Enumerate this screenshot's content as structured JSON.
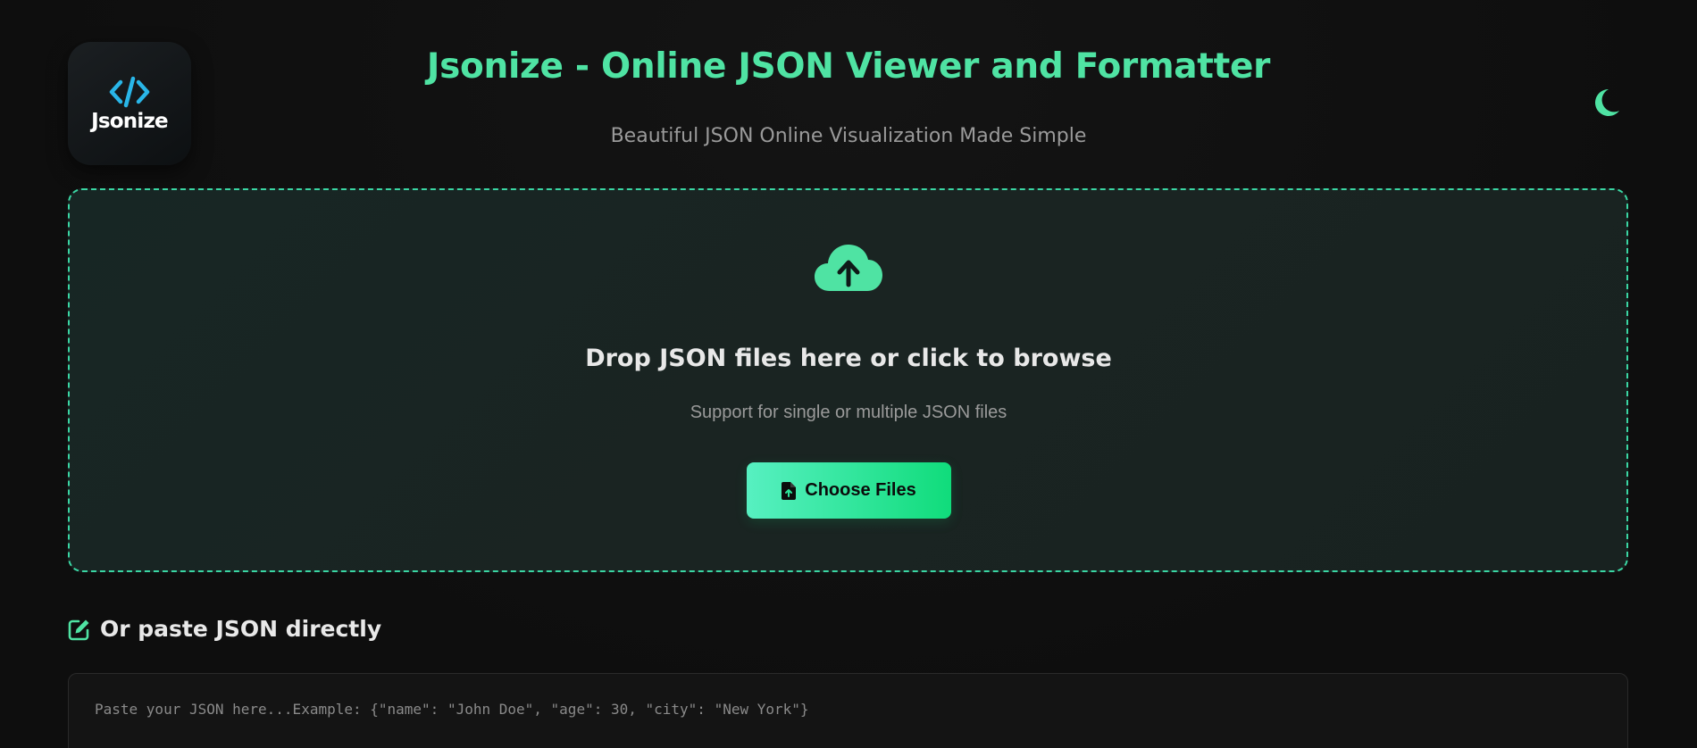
{
  "brand": {
    "logo_text": "Jsonize",
    "logo_icon": "code-brackets-icon",
    "accent_color": "#4fe3a3",
    "logo_icon_color": "#29b6e8"
  },
  "header": {
    "title": "Jsonize - Online JSON Viewer and Formatter",
    "subtitle": "Beautiful JSON Online Visualization Made Simple",
    "theme_toggle_icon": "moon-icon"
  },
  "dropzone": {
    "icon": "cloud-upload-icon",
    "heading": "Drop JSON files here or click to browse",
    "subtext": "Support for single or multiple JSON files",
    "button_label": "Choose Files",
    "button_icon": "file-upload-icon",
    "border_color": "#3ad6a3"
  },
  "paste": {
    "icon": "edit-icon",
    "heading": "Or paste JSON directly",
    "placeholder": "Paste your JSON here...Example: {\"name\": \"John Doe\", \"age\": 30, \"city\": \"New York\"}",
    "value": ""
  }
}
